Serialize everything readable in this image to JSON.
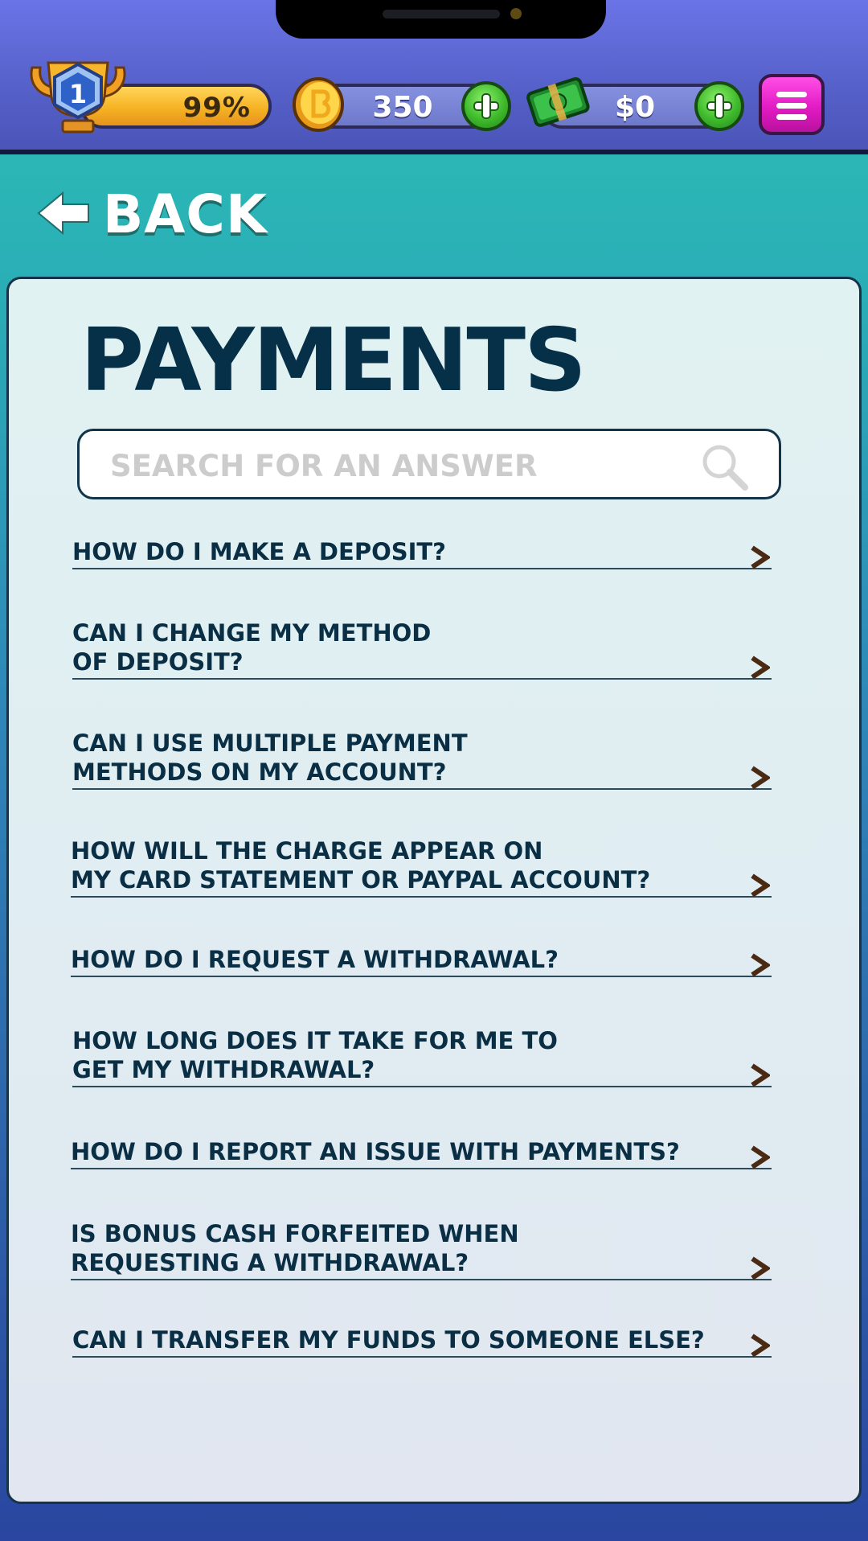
{
  "header": {
    "level": "1",
    "level_progress": "99%",
    "coins": "350",
    "cash": "$0",
    "icons": [
      "trophy-icon",
      "coin-icon",
      "cash-icon",
      "plus-icon",
      "menu-icon"
    ],
    "colors": {
      "bar": "#5560c9",
      "level": "#f6b324",
      "plus": "#3fba2c",
      "menu": "#e21bc4"
    }
  },
  "nav": {
    "back_label": "BACK"
  },
  "page": {
    "title": "PAYMENTS",
    "search_placeholder": "SEARCH FOR AN ANSWER"
  },
  "faq": {
    "items": [
      {
        "label": "HOW DO I MAKE A DEPOSIT?"
      },
      {
        "label": "CAN I CHANGE MY METHOD\nOF DEPOSIT?"
      },
      {
        "label": "CAN I USE MULTIPLE PAYMENT\nMETHODS ON MY ACCOUNT?"
      },
      {
        "label": "HOW WILL THE CHARGE APPEAR ON\nMY CARD STATEMENT OR PAYPAL ACCOUNT?"
      },
      {
        "label": "HOW DO I REQUEST A WITHDRAWAL?"
      },
      {
        "label": "HOW LONG DOES IT TAKE FOR ME TO\nGET MY WITHDRAWAL?"
      },
      {
        "label": "HOW DO I REPORT AN ISSUE WITH PAYMENTS?"
      },
      {
        "label": "IS BONUS CASH FORFEITED WHEN\nREQUESTING A WITHDRAWAL?"
      },
      {
        "label": "CAN I TRANSFER MY FUNDS TO SOMEONE ELSE?"
      }
    ]
  }
}
